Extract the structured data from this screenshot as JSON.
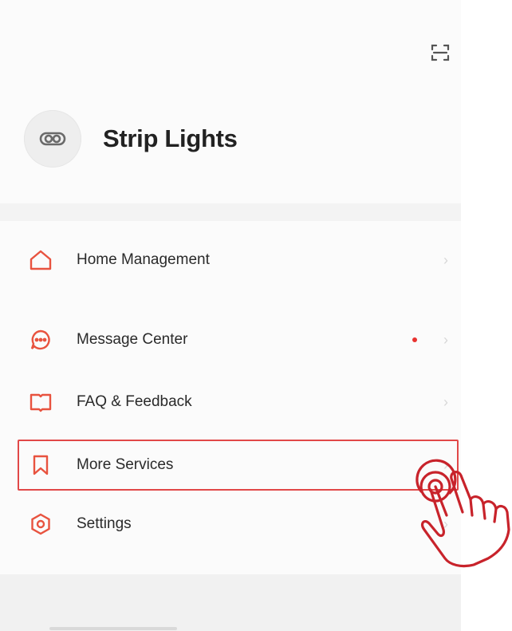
{
  "header": {
    "scan_icon": "scan-icon"
  },
  "profile": {
    "title": "Strip Lights",
    "avatar_icon": "device-link-icon"
  },
  "menu": [
    {
      "label": "Home Management",
      "icon": "home-icon",
      "badge": false
    },
    {
      "label": "Message Center",
      "icon": "chat-bubble-icon",
      "badge": true
    },
    {
      "label": "FAQ & Feedback",
      "icon": "book-icon",
      "badge": false
    },
    {
      "label": "More Services",
      "icon": "bookmark-icon",
      "badge": false,
      "highlighted": true
    },
    {
      "label": "Settings",
      "icon": "settings-icon",
      "badge": false
    }
  ],
  "colors": {
    "accent": "#e8533f",
    "highlight": "#e14848",
    "badge": "#e8322f"
  },
  "overlay": {
    "pointer_icon": "tap-hand-icon"
  }
}
